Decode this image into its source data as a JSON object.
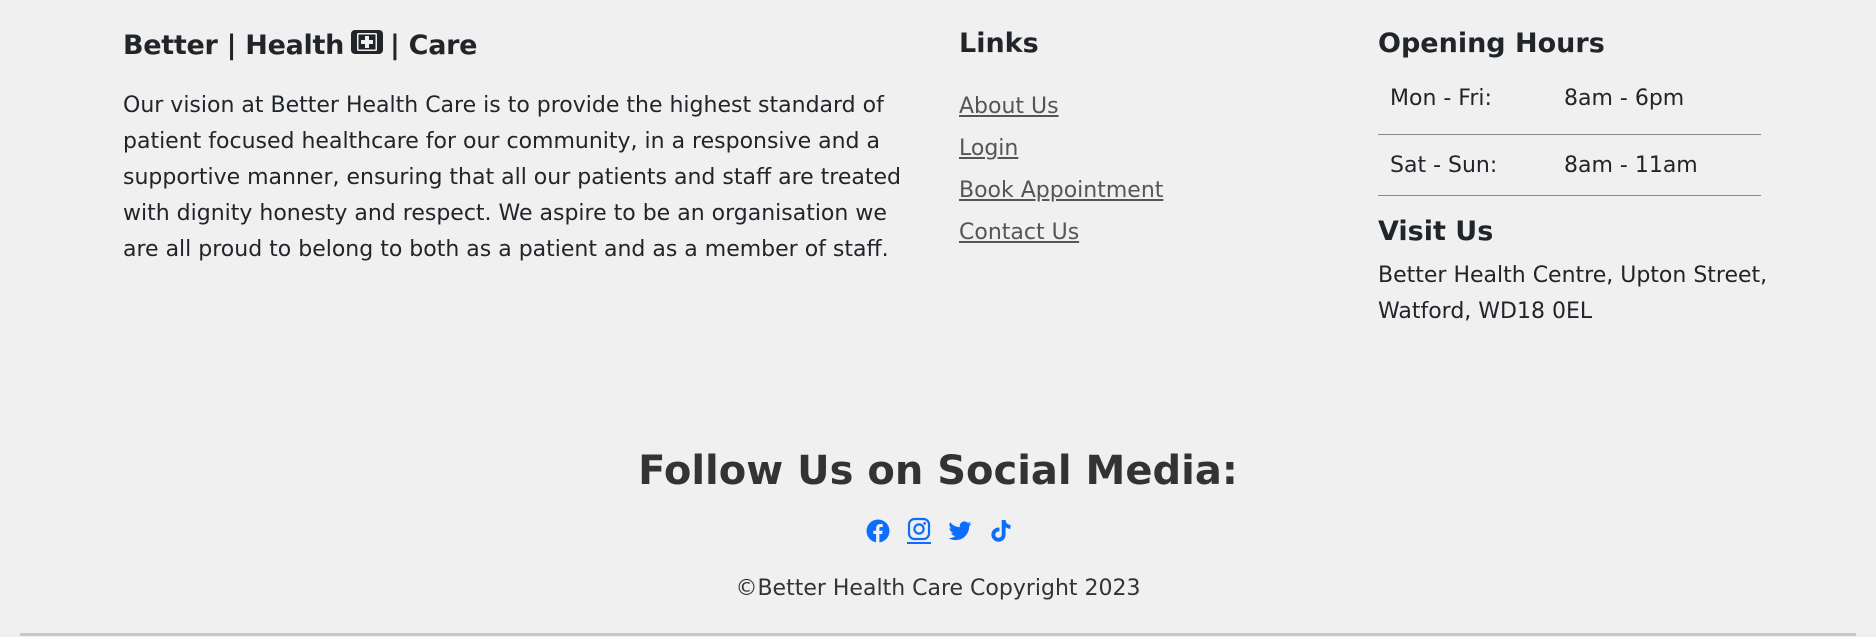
{
  "brand": {
    "part1": "Better | Health",
    "part2": "| Care",
    "icon": "medical-kit-icon"
  },
  "vision_text": "Our vision at Better Health Care is to provide the highest standard of patient focused healthcare for our community, in a responsive and a supportive manner, ensuring that all our patients and staff are treated with dignity honesty and respect. We aspire to be an organisation we are all proud to belong to both as a patient and as a member of staff.",
  "links": {
    "title": "Links",
    "items": [
      {
        "label": "About Us"
      },
      {
        "label": "Login"
      },
      {
        "label": "Book Appointment"
      },
      {
        "label": "Contact Us"
      }
    ]
  },
  "opening_hours": {
    "title": "Opening Hours",
    "rows": [
      {
        "day": "Mon - Fri:",
        "time": "8am - 6pm"
      },
      {
        "day": "Sat - Sun:",
        "time": "8am - 11am"
      }
    ]
  },
  "visit": {
    "title": "Visit Us",
    "address": "Better Health Centre, Upton Street, Watford, WD18 0EL"
  },
  "social": {
    "title": "Follow Us on Social Media:",
    "icons": [
      "facebook-icon",
      "instagram-icon",
      "twitter-icon",
      "tiktok-icon"
    ],
    "color": "#0d6efd"
  },
  "copyright": "©Better Health Care Copyright 2023"
}
